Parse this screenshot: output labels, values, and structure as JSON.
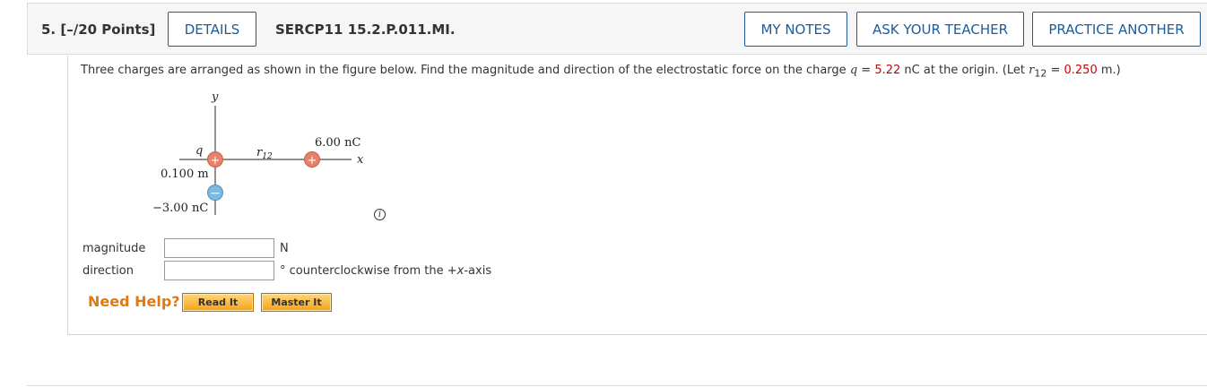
{
  "header": {
    "question_number": "5.",
    "points": "[–/20 Points]",
    "details_label": "DETAILS",
    "problem_code": "SERCP11 15.2.P.011.MI.",
    "my_notes_label": "MY NOTES",
    "ask_teacher_label": "ASK YOUR TEACHER",
    "practice_another_label": "PRACTICE ANOTHER"
  },
  "prompt": {
    "part1": "Three charges are arranged as shown in the figure below. Find the magnitude and direction of the electrostatic force on the charge ",
    "q_symbol": "q",
    "eq1": " = ",
    "q_value": "5.22",
    "q_unit": " nC at the origin. (Let ",
    "r_symbol": "r",
    "r_sub": "12",
    "eq2": " = ",
    "r_value": "0.250",
    "r_unit": " m.)"
  },
  "figure": {
    "y_axis_label": "y",
    "x_axis_label": "x",
    "q_label": "q",
    "r12_label": "r",
    "r12_sub": "12",
    "charge_right_label": "6.00 nC",
    "distance_label": "0.100 m",
    "charge_bottom_label": "−3.00 nC",
    "plus_sign": "+",
    "minus_sign": "−",
    "positive_color": "#e8806a",
    "negative_color": "#7fb8e0"
  },
  "answers": {
    "magnitude_label": "magnitude",
    "magnitude_value": "",
    "magnitude_unit": "N",
    "direction_label": "direction",
    "direction_value": "",
    "direction_unit_prefix": "° counterclockwise from the +",
    "direction_unit_axis": "x",
    "direction_unit_suffix": "-axis"
  },
  "help": {
    "title": "Need Help?",
    "read_it_label": "Read It",
    "master_it_label": "Master It"
  },
  "icons": {
    "info": "info-icon"
  },
  "colors": {
    "accent_blue": "#1f5a99",
    "given_value_red": "#cc0000",
    "help_orange": "#e07a10"
  }
}
